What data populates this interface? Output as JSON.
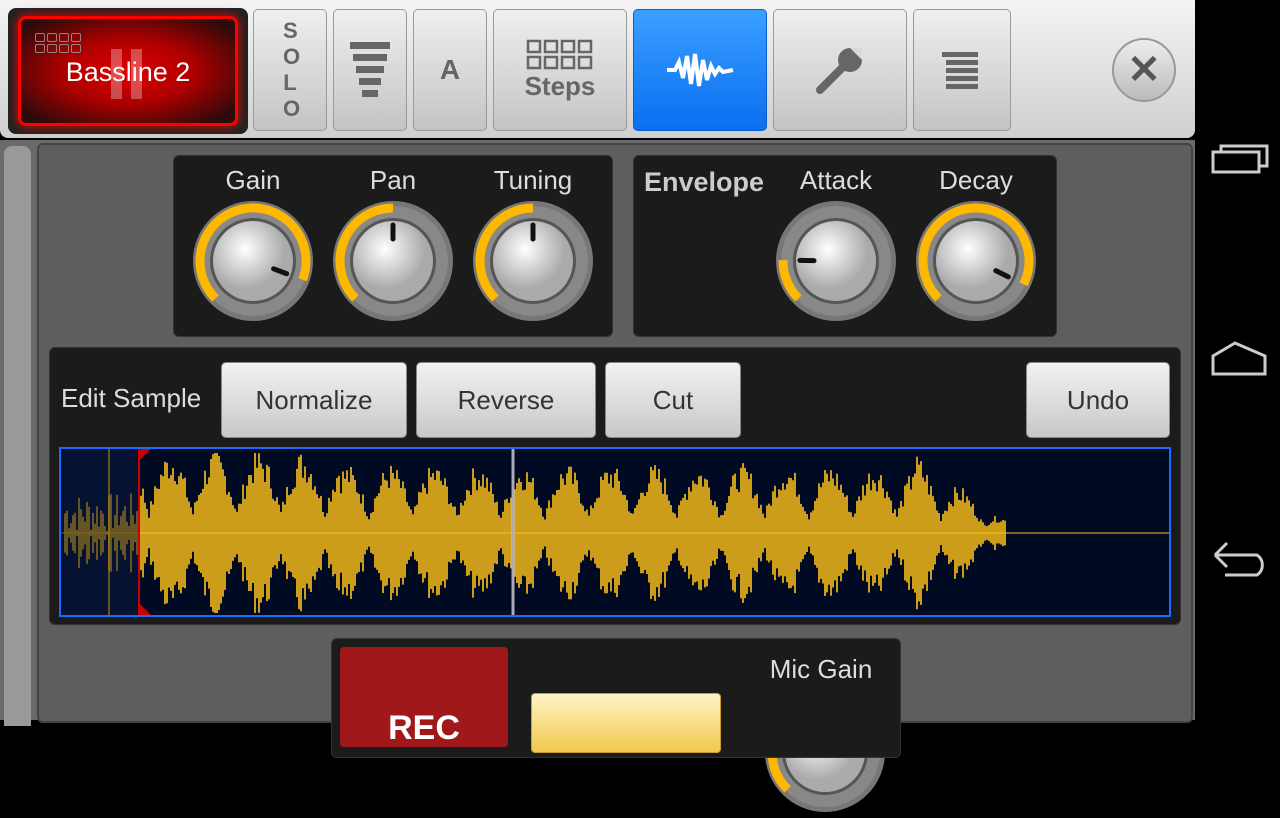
{
  "track": {
    "name": "Bassline 2"
  },
  "toolbar": {
    "solo": "S O L O",
    "a": "A",
    "steps": "Steps",
    "icons": [
      "mixer-icon",
      "steps-grid-icon",
      "waveform-icon",
      "wrench-icon",
      "menu-icon",
      "close-icon"
    ]
  },
  "knobs": [
    {
      "id": "gain",
      "label": "Gain",
      "value": 0.91
    },
    {
      "id": "pan",
      "label": "Pan",
      "value": 0.5
    },
    {
      "id": "tuning",
      "label": "Tuning",
      "value": 0.5
    },
    {
      "id": "attack",
      "label": "Attack",
      "value": 0.17
    },
    {
      "id": "decay",
      "label": "Decay",
      "value": 0.93
    }
  ],
  "envelope": {
    "title": "Envelope"
  },
  "edit": {
    "label": "Edit Sample",
    "normalize": "Normalize",
    "reverse": "Reverse",
    "cut": "Cut",
    "undo": "Undo"
  },
  "record": {
    "rec": "REC",
    "mic_gain_label": "Mic Gain",
    "mic_gain": 0.5
  },
  "colors": {
    "accent": "#ffb800",
    "active": "#1a82ff",
    "rec": "#a0181a",
    "wave": "#ffc21a"
  }
}
